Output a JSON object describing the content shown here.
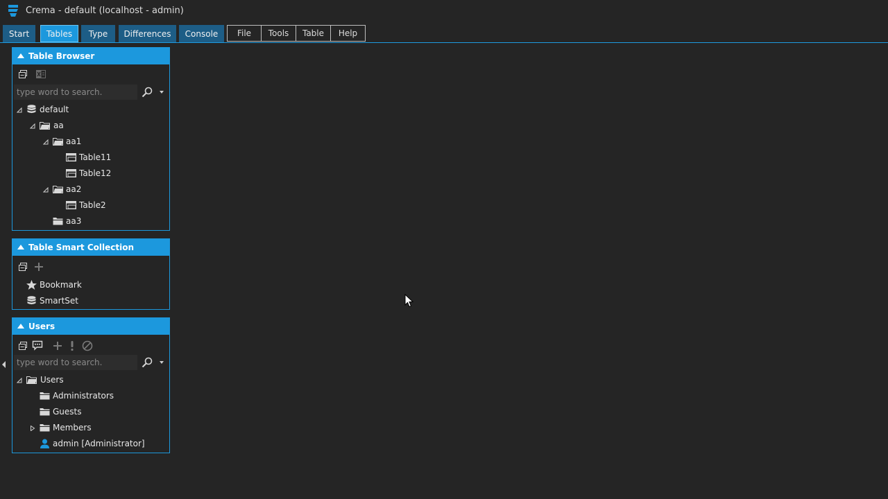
{
  "window": {
    "title": "Crema - default (localhost - admin)"
  },
  "tabs": [
    {
      "label": "Start",
      "active": false
    },
    {
      "label": "Tables",
      "active": true
    },
    {
      "label": "Type",
      "active": false
    },
    {
      "label": "Differences",
      "active": false
    },
    {
      "label": "Console",
      "active": false
    }
  ],
  "menus": [
    "File",
    "Tools",
    "Table",
    "Help"
  ],
  "colors": {
    "accent": "#1c98dd",
    "tab": "#1d5d86",
    "background": "#252525"
  },
  "table_browser": {
    "title": "Table Browser",
    "toolbar_icons": [
      "collapse-all-icon",
      "excel-export-icon"
    ],
    "search_placeholder": "type word to search.",
    "tree": [
      {
        "label": "default",
        "icon": "database-icon",
        "expanded": true
      },
      {
        "label": "aa",
        "icon": "folder-open-icon",
        "expanded": true
      },
      {
        "label": "aa1",
        "icon": "folder-open-icon",
        "expanded": true
      },
      {
        "label": "Table11",
        "icon": "table-icon"
      },
      {
        "label": "Table12",
        "icon": "table-icon"
      },
      {
        "label": "aa2",
        "icon": "folder-open-icon",
        "expanded": true
      },
      {
        "label": "Table2",
        "icon": "table-icon"
      },
      {
        "label": "aa3",
        "icon": "folder-icon"
      }
    ]
  },
  "smart_collection": {
    "title": "Table Smart Collection",
    "toolbar_icons": [
      "collapse-all-icon",
      "add-icon"
    ],
    "items": [
      {
        "label": "Bookmark",
        "icon": "star-icon"
      },
      {
        "label": "SmartSet",
        "icon": "database-icon"
      }
    ]
  },
  "users": {
    "title": "Users",
    "toolbar_icons": [
      "collapse-all-icon",
      "message-icon",
      "add-icon",
      "notify-icon",
      "ban-icon"
    ],
    "search_placeholder": "type word to search.",
    "tree": [
      {
        "label": "Users",
        "icon": "folder-open-icon",
        "expanded": true
      },
      {
        "label": "Administrators",
        "icon": "folder-icon"
      },
      {
        "label": "Guests",
        "icon": "folder-icon"
      },
      {
        "label": "Members",
        "icon": "folder-icon",
        "expanded": false
      },
      {
        "label": "admin [Administrator]",
        "icon": "user-icon"
      }
    ]
  }
}
